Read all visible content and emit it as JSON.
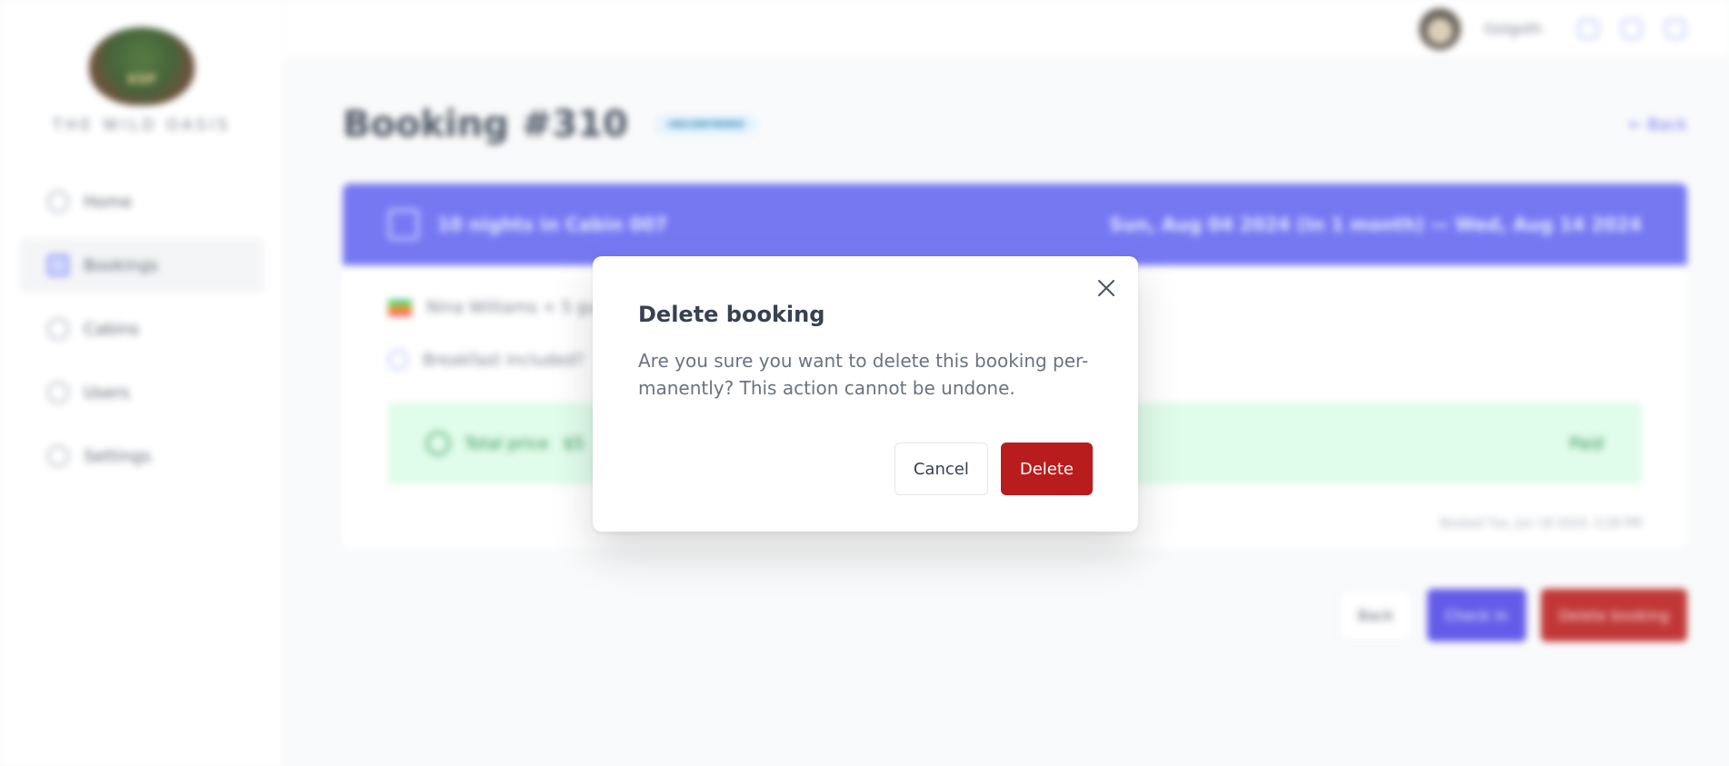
{
  "sidebar": {
    "logo_mark": "KSP",
    "logo_text": "THE WILD OASIS",
    "items": [
      {
        "label": "Home"
      },
      {
        "label": "Bookings"
      },
      {
        "label": "Cabins"
      },
      {
        "label": "Users"
      },
      {
        "label": "Settings"
      }
    ]
  },
  "header": {
    "user_name": "Golgoth"
  },
  "main": {
    "title": "Booking #310",
    "status": "unconfirmed",
    "back_link": "← Back",
    "booking_header_left": "10 nights in Cabin 007",
    "booking_header_right": "Sun, Aug 04 2024 (In 1 month) — Wed, Aug 14 2024",
    "guest": "Nina Williams + 5 guests",
    "breakfast": "Breakfast included?",
    "price_label": "Total price",
    "price_value": "$5",
    "price_status": "Paid",
    "created_at": "Booked Tue, Jun 18 2024, 3:28 PM",
    "actions": {
      "back": "Back",
      "check_in": "Check in",
      "delete": "Delete booking"
    }
  },
  "modal": {
    "title": "Delete booking",
    "message": "Are you sure you want to delete this booking per-manently? This action cannot be undone.",
    "cancel": "Cancel",
    "delete": "Delete"
  },
  "colors": {
    "accent": "#6366f1",
    "danger": "#b91c1c",
    "success_bg": "#dcfce7"
  }
}
